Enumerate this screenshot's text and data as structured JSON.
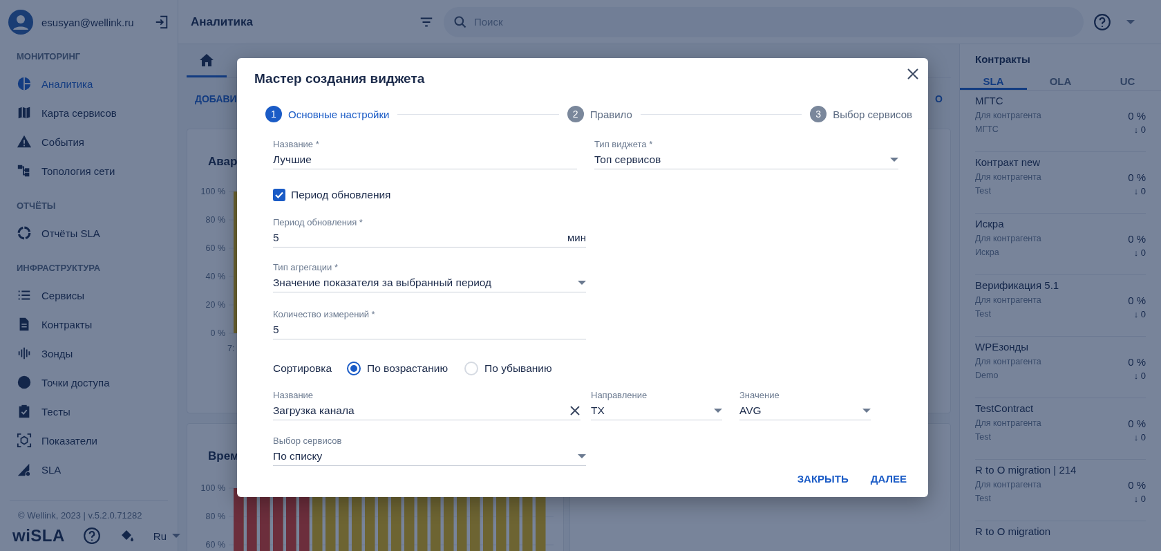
{
  "sidebar": {
    "user": {
      "email": "esusyan@wellink.ru"
    },
    "sections": [
      {
        "title": "МОНИТОРИНГ",
        "items": [
          {
            "label": "Аналитика",
            "selected": true
          },
          {
            "label": "Карта сервисов",
            "selected": false
          },
          {
            "label": "События",
            "selected": false
          },
          {
            "label": "Топология сети",
            "selected": false
          }
        ]
      },
      {
        "title": "ОТЧЁТЫ",
        "items": [
          {
            "label": "Отчёты SLA",
            "selected": false
          }
        ]
      },
      {
        "title": "ИНФРАСТРУКТУРА",
        "items": [
          {
            "label": "Сервисы",
            "selected": false
          },
          {
            "label": "Контракты",
            "selected": false
          },
          {
            "label": "Зонды",
            "selected": false
          },
          {
            "label": "Точки доступа",
            "selected": false
          },
          {
            "label": "Тесты",
            "selected": false
          },
          {
            "label": "Показатели",
            "selected": false
          },
          {
            "label": "SLA",
            "selected": false
          }
        ]
      }
    ],
    "footer": {
      "copyright": "© Wellink, 2023 | v.5.2.0.71282",
      "logo": "wiSLA",
      "language": "Ru"
    }
  },
  "topbar": {
    "title": "Аналитика",
    "search": {
      "placeholder": "Поиск"
    }
  },
  "dashboard": {
    "tabs": [
      {
        "selected": true
      }
    ],
    "add_button": "ДОБАВИ",
    "right_button": "О",
    "cards": [
      {
        "title": "Авар",
        "y_ticks": [
          "100 %",
          "80 %",
          "60 %",
          "40 %",
          "20 %",
          "0 %"
        ],
        "x_labels": [
          "7:"
        ]
      },
      {
        "title": "Врем",
        "y_ticks": [
          "100 %",
          "80 %",
          "60 %"
        ]
      }
    ]
  },
  "contracts": {
    "title": "Контракты",
    "tabs": [
      {
        "label": "SLA",
        "selected": true
      },
      {
        "label": "OLA",
        "selected": false
      },
      {
        "label": "UC",
        "selected": false
      }
    ],
    "items": [
      {
        "name": "МГТС",
        "type": "Для контрагента",
        "party": "МГТС",
        "percent": "0 %",
        "trend": "↓ 0"
      },
      {
        "name": "Контракт new",
        "type": "Для контрагента",
        "party": "Test",
        "percent": "0 %",
        "trend": "↓ 0"
      },
      {
        "name": "Искра",
        "type": "Для контрагента",
        "party": "Искра",
        "percent": "0 %",
        "trend": "↓ 0"
      },
      {
        "name": "Верификация 5.1",
        "type": "Для контрагента",
        "party": "Test",
        "percent": "0 %",
        "trend": "↓ 0"
      },
      {
        "name": "WPEзонды",
        "type": "Для контрагента",
        "party": "Demo",
        "percent": "0 %",
        "trend": "↓ 0"
      },
      {
        "name": "TestContract",
        "type": "Для контрагента",
        "party": "Test",
        "percent": "0 %",
        "trend": "↓ 0"
      },
      {
        "name": "R to O migration | 214",
        "type": "Для контрагента",
        "party": "Test",
        "percent": "0 %",
        "trend": "↓ 0"
      },
      {
        "name": "R to O migration"
      }
    ]
  },
  "dialog": {
    "title": "Мастер создания виджета",
    "steps": [
      {
        "number": "1",
        "label": "Основные настройки",
        "selected": true
      },
      {
        "number": "2",
        "label": "Правило",
        "selected": false
      },
      {
        "number": "3",
        "label": "Выбор сервисов",
        "selected": false
      }
    ],
    "name_field": {
      "label": "Название *",
      "value": "Лучшие"
    },
    "widget_type": {
      "label": "Тип виджета *",
      "value": "Топ сервисов"
    },
    "update_checkbox": {
      "label": "Период обновления",
      "checked": true
    },
    "period_field": {
      "label": "Период обновления *",
      "value": "5",
      "unit": "мин"
    },
    "aggregation": {
      "label": "Тип агрегации *",
      "value": "Значение показателя за выбранный период"
    },
    "count_field": {
      "label": "Количество измерений *",
      "value": "5"
    },
    "sorting": {
      "label": "Сортировка",
      "options": [
        {
          "label": "По возрастанию",
          "selected": true
        },
        {
          "label": "По убыванию",
          "selected": false
        }
      ]
    },
    "metric": {
      "label": "Название",
      "value": "Загрузка канала"
    },
    "direction": {
      "label": "Направление",
      "value": "TX"
    },
    "stat": {
      "label": "Значение",
      "value": "AVG"
    },
    "services": {
      "label": "Выбор сервисов",
      "value": "По списку"
    },
    "buttons": [
      "ЗАКРЫТЬ",
      "ДАЛЕЕ"
    ]
  }
}
